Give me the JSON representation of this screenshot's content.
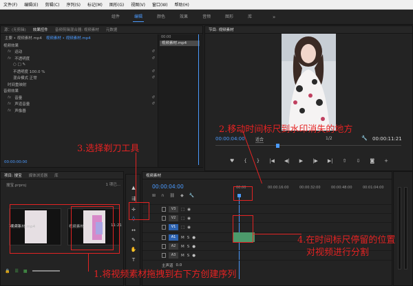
{
  "menu": [
    "文件(F)",
    "编辑(E)",
    "剪辑(C)",
    "序列(S)",
    "标记(M)",
    "图形(G)",
    "视图(V)",
    "窗口(W)",
    "帮助(H)"
  ],
  "workspaces": [
    "组件",
    "编辑",
    "颜色",
    "效果",
    "音频",
    "图形",
    "库"
  ],
  "workspaces_more": "»",
  "effect_panel": {
    "tabs": [
      "源：(无剪辑)",
      "效果控件",
      "音频剪辑混合器: 视频素材",
      "元数据"
    ],
    "master": "主要 • 视频素材.mp4",
    "sequence": "视频素材 • 视频素材.mp4",
    "rows": [
      {
        "fx": "",
        "label": "视频效果"
      },
      {
        "fx": "fx",
        "label": "运动"
      },
      {
        "fx": "fx",
        "label": "不透明度"
      },
      {
        "fx": "",
        "label": "○ □ ✎"
      },
      {
        "fx": "",
        "label": "不透明度          100.0 %"
      },
      {
        "fx": "",
        "label": "混合模式          正常"
      },
      {
        "fx": "",
        "label": "时间重映射"
      },
      {
        "fx": "",
        "label": "音频效果"
      },
      {
        "fx": "fx",
        "label": "音量"
      },
      {
        "fx": "fx",
        "label": "声道音量"
      },
      {
        "fx": "fx",
        "label": "声像器"
      }
    ],
    "clip_name": "视频素材.mp4",
    "ruler_time": "00:00",
    "timecode": "00:00:00:00"
  },
  "program": {
    "title": "节目: 视频素材",
    "timecode": "00:00:04:00",
    "fit": "适合",
    "resolution": "1/2",
    "duration": "00:00:11:21",
    "buttons": [
      "♥",
      "{",
      "}",
      "|◀",
      "◀|",
      "▶",
      "|▶",
      "▶|",
      "⇧",
      "⇩",
      "◙",
      "+"
    ]
  },
  "project": {
    "tabs": [
      "项目: 搜宝",
      "媒体浏览器",
      "库"
    ],
    "path": "搜宝.prproj",
    "count": "1 项已...",
    "items": [
      {
        "label": "视频素材.mp4",
        "duration": "11:21"
      },
      {
        "label": "视频素材",
        "duration": "11:21"
      }
    ]
  },
  "timeline": {
    "tab": "视频素材",
    "timecode": "00:00:04:00",
    "ticks": [
      "00:00",
      "00:00:16:00",
      "00:00:32:00",
      "00:00:48:00",
      "00:01:04:00"
    ],
    "tracks": [
      "V3",
      "V2",
      "V1",
      "A1",
      "A2",
      "A3"
    ],
    "master": "主声道",
    "master_value": "0.0"
  },
  "annotations": {
    "a1": "1.将视频素材拖拽到右下方创建序列",
    "a2": "2.移动时间标尺到水印消失的地方",
    "a3": "3.选择剃刀工具",
    "a4a": "4.在时间标尺停留的位置",
    "a4b": "对视频进行分割"
  },
  "colors": {
    "accent": "#4b9bff",
    "annotation": "#e52323",
    "clip_video": "#d789c9",
    "clip_audio": "#4c9a6b"
  }
}
